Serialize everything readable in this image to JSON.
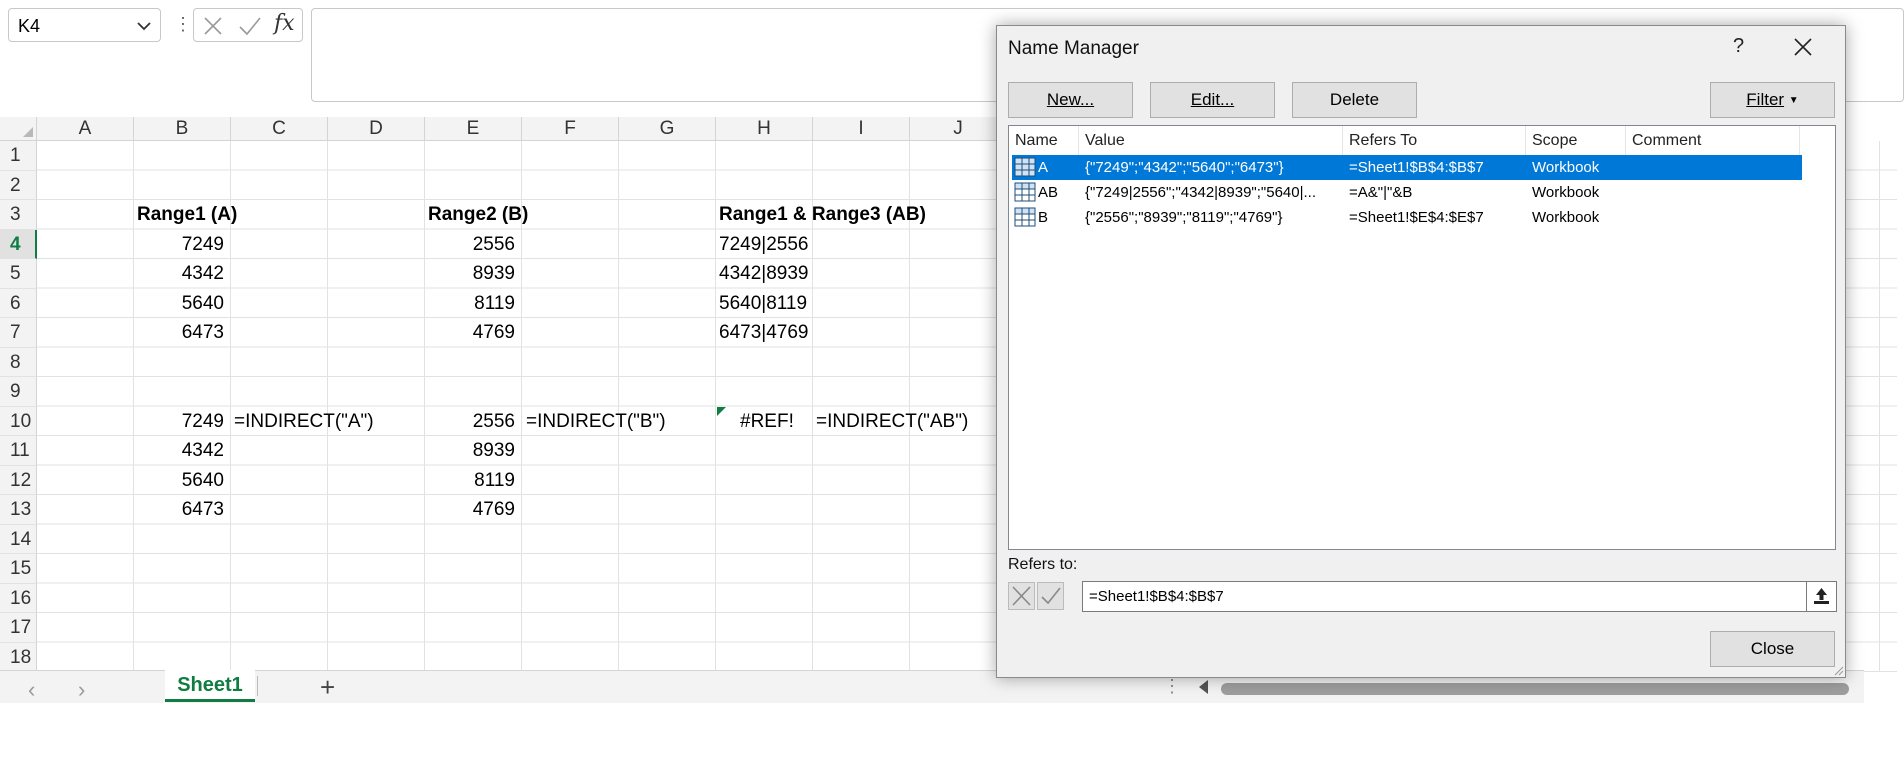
{
  "formula_bar": {
    "name_box": "K4",
    "formula": ""
  },
  "grid": {
    "columns": [
      "A",
      "B",
      "C",
      "D",
      "E",
      "F",
      "G",
      "H",
      "I",
      "J"
    ],
    "rows": [
      "1",
      "2",
      "3",
      "4",
      "5",
      "6",
      "7",
      "8",
      "9",
      "10",
      "11",
      "12",
      "13",
      "14",
      "15",
      "16",
      "17",
      "18"
    ],
    "headings": {
      "b3": "Range1 (A)",
      "e3": "Range2 (B)",
      "h3": "Range1 & Range3 (AB)"
    },
    "range_a": [
      "7249",
      "4342",
      "5640",
      "6473"
    ],
    "range_b": [
      "2556",
      "8939",
      "8119",
      "4769"
    ],
    "range_ab": [
      "7249|2556",
      "4342|8939",
      "5640|8119",
      "6473|4769"
    ],
    "spill_a": [
      "7249",
      "4342",
      "5640",
      "6473"
    ],
    "spill_b": [
      "2556",
      "8939",
      "8119",
      "4769"
    ],
    "formula_c10": "=INDIRECT(\"A\")",
    "formula_f10": "=INDIRECT(\"B\")",
    "error_h10": "#REF!",
    "formula_i10": "=INDIRECT(\"AB\")"
  },
  "sheet_tabs": {
    "active": "Sheet1",
    "add_label": "+"
  },
  "dialog": {
    "title": "Name Manager",
    "help": "?",
    "buttons": {
      "new": "New...",
      "edit": "Edit...",
      "delete": "Delete",
      "filter": "Filter",
      "close": "Close"
    },
    "columns": [
      "Name",
      "Value",
      "Refers To",
      "Scope",
      "Comment"
    ],
    "names": [
      {
        "name": "A",
        "value": "{\"7249\";\"4342\";\"5640\";\"6473\"}",
        "refers_to": "=Sheet1!$B$4:$B$7",
        "scope": "Workbook",
        "comment": ""
      },
      {
        "name": "AB",
        "value": "{\"7249|2556\";\"4342|8939\";\"5640|...",
        "refers_to": "=A&\"|\"&B",
        "scope": "Workbook",
        "comment": ""
      },
      {
        "name": "B",
        "value": "{\"2556\";\"8939\";\"8119\";\"4769\"}",
        "refers_to": "=Sheet1!$E$4:$E$7",
        "scope": "Workbook",
        "comment": ""
      }
    ],
    "refers_to_label": "Refers to:",
    "refers_to_value": "=Sheet1!$B$4:$B$7",
    "accent": "#0078d7"
  },
  "icons": {
    "name_box_dropdown": "chevron-down-icon",
    "cancel_entry": "cancel-icon",
    "enter_entry": "check-icon",
    "insert_function": "fx-icon",
    "table_name": "table-icon",
    "collapse_dialog": "collapse-dialog-icon"
  }
}
